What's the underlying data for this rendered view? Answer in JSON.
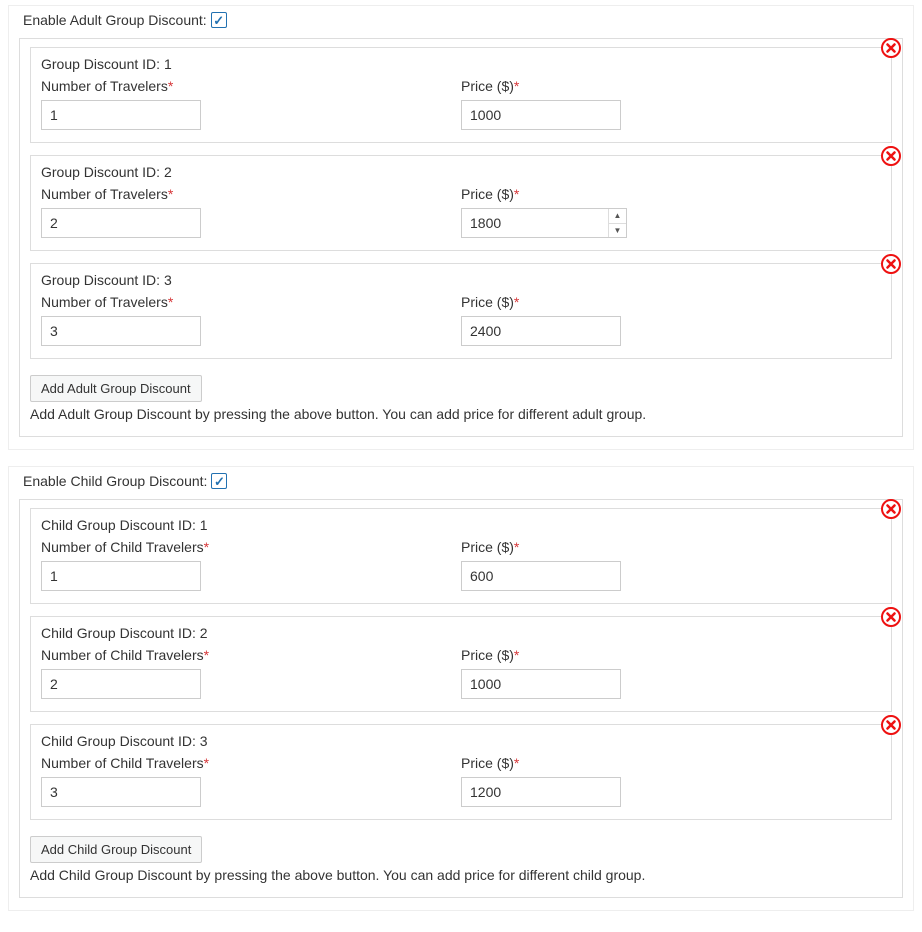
{
  "adult": {
    "enable_label": "Enable Adult Group Discount:",
    "enable_checked": true,
    "rows": [
      {
        "title": "Group Discount ID: 1",
        "travelers_label": "Number of Travelers",
        "travelers_value": "1",
        "price_label": "Price ($)",
        "price_value": "1000",
        "show_spinner": false
      },
      {
        "title": "Group Discount ID: 2",
        "travelers_label": "Number of Travelers",
        "travelers_value": "2",
        "price_label": "Price ($)",
        "price_value": "1800",
        "show_spinner": true
      },
      {
        "title": "Group Discount ID: 3",
        "travelers_label": "Number of Travelers",
        "travelers_value": "3",
        "price_label": "Price ($)",
        "price_value": "2400",
        "show_spinner": false
      }
    ],
    "add_button": "Add Adult Group Discount",
    "help": "Add Adult Group Discount by pressing the above button. You can add price for different adult group."
  },
  "child": {
    "enable_label": "Enable Child Group Discount:",
    "enable_checked": true,
    "rows": [
      {
        "title": "Child Group Discount ID: 1",
        "travelers_label": "Number of Child Travelers",
        "travelers_value": "1",
        "price_label": "Price ($)",
        "price_value": "600",
        "show_spinner": false
      },
      {
        "title": "Child Group Discount ID: 2",
        "travelers_label": "Number of Child Travelers",
        "travelers_value": "2",
        "price_label": "Price ($)",
        "price_value": "1000",
        "show_spinner": false
      },
      {
        "title": "Child Group Discount ID: 3",
        "travelers_label": "Number of Child Travelers",
        "travelers_value": "3",
        "price_label": "Price ($)",
        "price_value": "1200",
        "show_spinner": false
      }
    ],
    "add_button": "Add Child Group Discount",
    "help": "Add Child Group Discount by pressing the above button. You can add price for different child group."
  }
}
